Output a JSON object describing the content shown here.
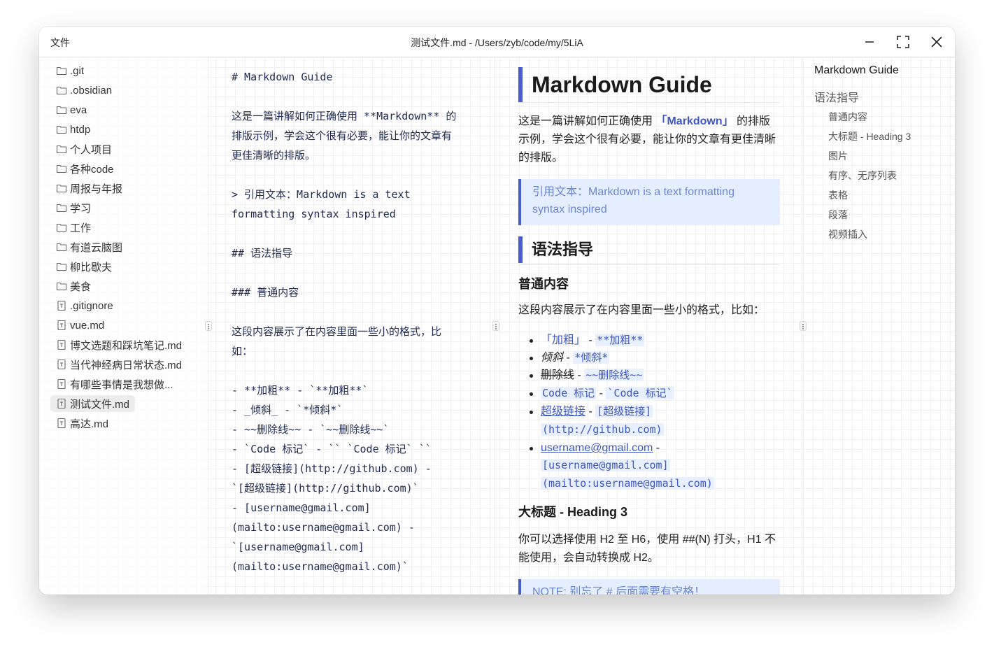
{
  "titlebar": {
    "files_label": "文件",
    "title": "测试文件.md - /Users/zyb/code/my/5LiA"
  },
  "sidebar": {
    "items": [
      {
        "label": ".git",
        "type": "folder"
      },
      {
        "label": ".obsidian",
        "type": "folder"
      },
      {
        "label": "eva",
        "type": "folder"
      },
      {
        "label": "htdp",
        "type": "folder"
      },
      {
        "label": "个人项目",
        "type": "folder"
      },
      {
        "label": "各种code",
        "type": "folder"
      },
      {
        "label": "周报与年报",
        "type": "folder"
      },
      {
        "label": "学习",
        "type": "folder"
      },
      {
        "label": "工作",
        "type": "folder"
      },
      {
        "label": "有道云脑图",
        "type": "folder"
      },
      {
        "label": "柳比歇夫",
        "type": "folder"
      },
      {
        "label": "美食",
        "type": "folder"
      },
      {
        "label": ".gitignore",
        "type": "file"
      },
      {
        "label": "vue.md",
        "type": "file"
      },
      {
        "label": "博文选题和踩坑笔记.md",
        "type": "file"
      },
      {
        "label": "当代神经病日常状态.md",
        "type": "file"
      },
      {
        "label": "有哪些事情是我想做...",
        "type": "file"
      },
      {
        "label": "测试文件.md",
        "type": "file",
        "active": true
      },
      {
        "label": "高达.md",
        "type": "file"
      }
    ]
  },
  "editor": {
    "lines": [
      "# Markdown Guide",
      "",
      "这是一篇讲解如何正确使用 **Markdown** 的",
      "排版示例，学会这个很有必要，能让你的文章有",
      "更佳清晰的排版。",
      "",
      "> 引用文本：Markdown is a text",
      "formatting syntax inspired",
      "",
      "## 语法指导",
      "",
      "### 普通内容",
      "",
      "这段内容展示了在内容里面一些小的格式，比",
      "如：",
      "",
      "- **加粗** - `**加粗**`",
      "- _倾斜_ - `*倾斜*`",
      "- ~~删除线~~ - `~~删除线~~`",
      "- `Code 标记` - `` `Code 标记` ``",
      "- [超级链接](http://github.com) -",
      "`[超级链接](http://github.com)`",
      "- [username@gmail.com]",
      "(mailto:username@gmail.com) -",
      "`[username@gmail.com]",
      "(mailto:username@gmail.com)`"
    ]
  },
  "preview": {
    "h1": "Markdown Guide",
    "intro": {
      "before": "这是一篇讲解如何正确使用",
      "accent": "「Markdown」",
      "after_line1": "的排版",
      "line2": "示例，学会这个很有必要，能让你的文章有更佳清晰",
      "line3": "的排版。"
    },
    "quote": {
      "line1": "引用文本：Markdown is a text formatting",
      "line2": "syntax inspired"
    },
    "h2": "语法指导",
    "h3_normal": "普通内容",
    "normal_para": "这段内容展示了在内容里面一些小的格式，比如：",
    "list": {
      "bold_label": "「加粗」",
      "bold_code": "**加粗**",
      "italic_label": "倾斜",
      "italic_code": "*倾斜*",
      "strike_label": "删除线",
      "strike_code": "~~删除线~~",
      "code_label": "Code 标记",
      "code_code": "`Code 标记`",
      "link_label": "超级链接",
      "link_code_1": "[超级链接]",
      "link_code_2": "(http://github.com)",
      "email_label": "username@gmail.com",
      "email_code_1": "[username@gmail.com]",
      "email_code_2": "(mailto:username@gmail.com)",
      "sep": "-"
    },
    "h3_heading3": "大标题 - Heading 3",
    "heading3_para": {
      "line1": "你可以选择使用 H2 至 H6，使用 ##(N) 打头，H1 不",
      "line2": "能使用，会自动转换成 H2。"
    },
    "note": "NOTE: 别忘了 # 后面需要有空格！"
  },
  "outline": {
    "items": [
      {
        "label": "Markdown Guide",
        "level": 1
      },
      {
        "label": "语法指导",
        "level": 2
      },
      {
        "label": "普通内容",
        "level": 3
      },
      {
        "label": "大标题 - Heading 3",
        "level": 3
      },
      {
        "label": "图片",
        "level": 3
      },
      {
        "label": "有序、无序列表",
        "level": 3
      },
      {
        "label": "表格",
        "level": 3
      },
      {
        "label": "段落",
        "level": 3
      },
      {
        "label": "视频插入",
        "level": 3
      }
    ]
  },
  "colors": {
    "accent": "#4a5ccb",
    "link": "#3e58c8",
    "quote_bg": "#e5eeff",
    "editor_text": "#1e2a55"
  }
}
